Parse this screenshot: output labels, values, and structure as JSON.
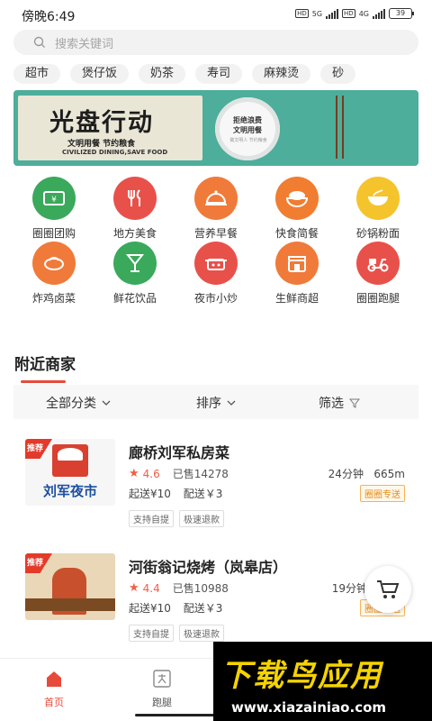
{
  "status_bar": {
    "time": "傍晚6:49",
    "net1": "5G",
    "net2": "4G",
    "hd": "HD",
    "battery": "39"
  },
  "search": {
    "placeholder": "搜索关键词"
  },
  "pills": [
    "超市",
    "煲仔饭",
    "奶茶",
    "寿司",
    "麻辣烫",
    "砂"
  ],
  "banner": {
    "title": "光盘行动",
    "sub1": "文明用餐 节约粮食",
    "sub2": "CIVILIZED DINING,SAVE FOOD",
    "plate_text": "拒绝浪费\n文明用餐",
    "plate_small": "做文明人 节约粮食"
  },
  "grid": [
    {
      "label": "圈圈团购",
      "color": "#3aa95b",
      "icon": "ticket-icon"
    },
    {
      "label": "地方美食",
      "color": "#e8514a",
      "icon": "fork-knife-icon"
    },
    {
      "label": "营养早餐",
      "color": "#f07a3a",
      "icon": "cloche-icon"
    },
    {
      "label": "快食简餐",
      "color": "#f17d31",
      "icon": "rice-bowl-icon"
    },
    {
      "label": "砂锅粉面",
      "color": "#f5c32c",
      "icon": "noodle-bowl-icon"
    },
    {
      "label": "炸鸡卤菜",
      "color": "#f07a3a",
      "icon": "chicken-icon"
    },
    {
      "label": "鲜花饮品",
      "color": "#3aa95b",
      "icon": "cocktail-icon"
    },
    {
      "label": "夜市小炒",
      "color": "#e8514a",
      "icon": "wok-icon"
    },
    {
      "label": "生鲜商超",
      "color": "#f07a3a",
      "icon": "market-icon"
    },
    {
      "label": "圈圈跑腿",
      "color": "#e8514a",
      "icon": "scooter-icon"
    }
  ],
  "section": {
    "title": "附近商家"
  },
  "filters": {
    "category": "全部分类",
    "sort": "排序",
    "filter": "筛选"
  },
  "merchants": [
    {
      "name": "廊桥刘军私房菜",
      "tag": "推荐",
      "score": "4.6",
      "sold": "已售14278",
      "time": "24分钟",
      "distance": "665m",
      "min_order": "起送¥10",
      "delivery": "配送￥3",
      "badge": "圈圈专送",
      "tags": [
        "支持自提",
        "极速退款"
      ],
      "thumb_text": "刘军夜市"
    },
    {
      "name": "河街翁记烧烤（岚皋店）",
      "tag": "推荐",
      "score": "4.4",
      "sold": "已售10988",
      "time": "19分钟",
      "distance": "",
      "min_order": "起送¥10",
      "delivery": "配送￥3",
      "badge": "圈圈专送",
      "tags": [
        "支持自提",
        "极速退款"
      ],
      "thumb_text": ""
    }
  ],
  "tabbar": {
    "home": "首页",
    "errand": "跑腿"
  },
  "watermark": {
    "big": "下载鸟应用",
    "url": "www.xiazainiao.com"
  },
  "colors": {
    "accent": "#e74a3b",
    "banner": "#4cae9b",
    "badge": "#e48a1b"
  }
}
